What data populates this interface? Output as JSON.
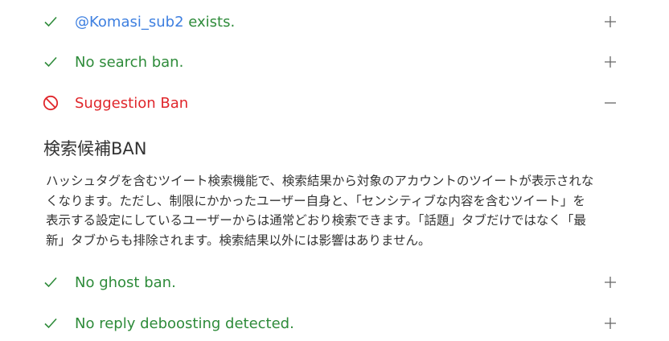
{
  "colors": {
    "ok": "#2e8b3a",
    "ban": "#e0262b",
    "link": "#3d7fe0",
    "text": "#333333"
  },
  "checks": [
    {
      "status": "ok",
      "icon": "check-icon",
      "handle": "@Komasi_sub2",
      "label": " exists.",
      "toggle": "plus-icon"
    },
    {
      "status": "ok",
      "icon": "check-icon",
      "label": "No search ban.",
      "toggle": "plus-icon"
    },
    {
      "status": "ban",
      "icon": "ban-icon",
      "label": "Suggestion Ban",
      "toggle": "minus-icon"
    },
    {
      "status": "ok",
      "icon": "check-icon",
      "label": "No ghost ban.",
      "toggle": "plus-icon"
    },
    {
      "status": "ok",
      "icon": "check-icon",
      "label": "No reply deboosting detected.",
      "toggle": "plus-icon"
    }
  ],
  "detail": {
    "title": "検索候補BAN",
    "lines": [
      "ハッシュタグを含むツイート検索機能で、検索結果から対象のアカウントのツイートが表示されな",
      "くなります。ただし、制限にかかったユーザー自身と、「センシティブな内容を含むツイート」を",
      "表示する設定にしているユーザーからは通常どおり検索できます。「話題」タブだけではなく「最",
      "新」タブからも排除されます。検索結果以外には影響はありません。"
    ]
  }
}
